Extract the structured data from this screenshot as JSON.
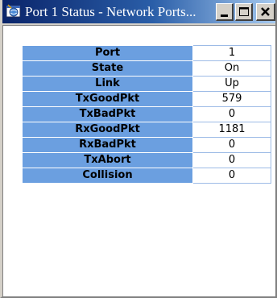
{
  "window": {
    "title": "Port 1 Status - Network Ports...",
    "controls": {
      "minimize_icon": "minimize-icon",
      "maximize_icon": "maximize-icon",
      "close_icon": "close-icon"
    }
  },
  "colors": {
    "title_bar_start": "#0a246a",
    "title_bar_end": "#a6caf0",
    "label_cell": "#6b9fe0",
    "value_cell": "#ffffff"
  },
  "status": {
    "rows": [
      {
        "label": "Port",
        "value": "1"
      },
      {
        "label": "State",
        "value": "On"
      },
      {
        "label": "Link",
        "value": "Up"
      },
      {
        "label": "TxGoodPkt",
        "value": "579"
      },
      {
        "label": "TxBadPkt",
        "value": "0"
      },
      {
        "label": "RxGoodPkt",
        "value": "1181"
      },
      {
        "label": "RxBadPkt",
        "value": "0"
      },
      {
        "label": "TxAbort",
        "value": "0"
      },
      {
        "label": "Collision",
        "value": "0"
      }
    ]
  }
}
